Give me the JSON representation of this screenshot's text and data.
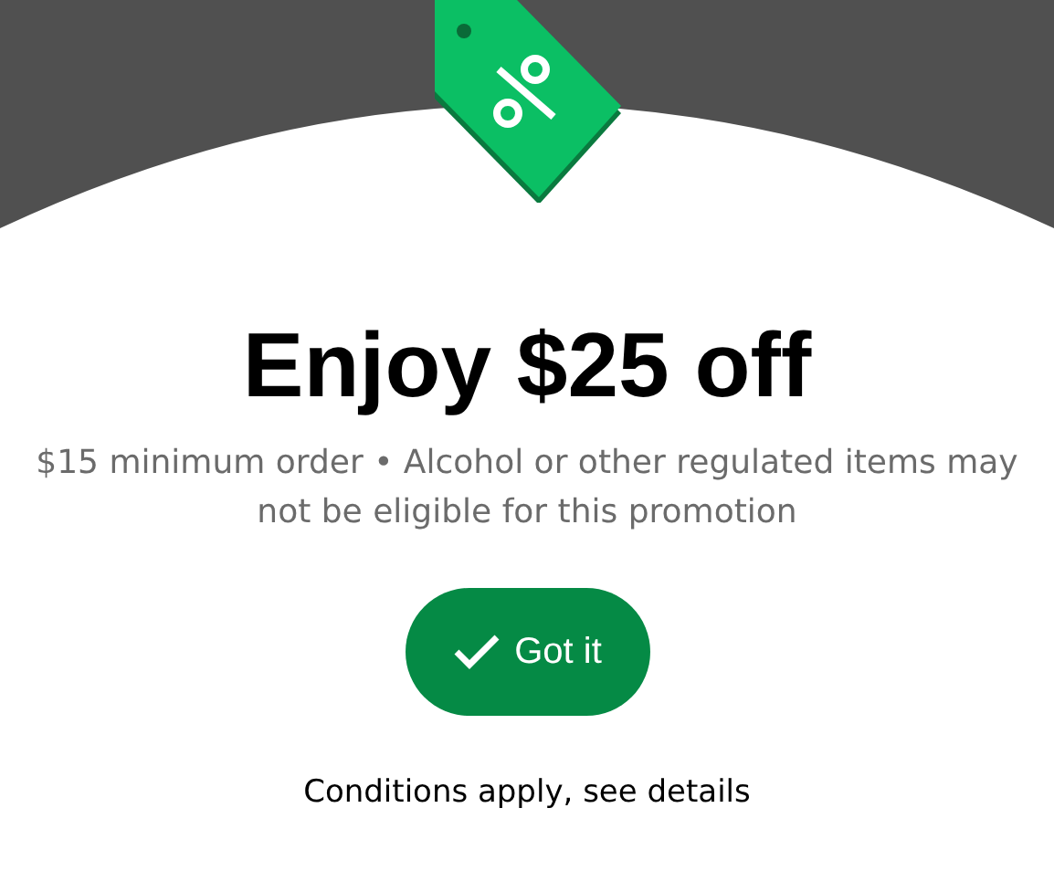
{
  "promo": {
    "title": "Enjoy $25 off",
    "description": "$15 minimum order • Alcohol or other regulated items may not be eligible for this promotion",
    "button": {
      "label": "Got it"
    },
    "link": "Conditions apply, see details"
  }
}
